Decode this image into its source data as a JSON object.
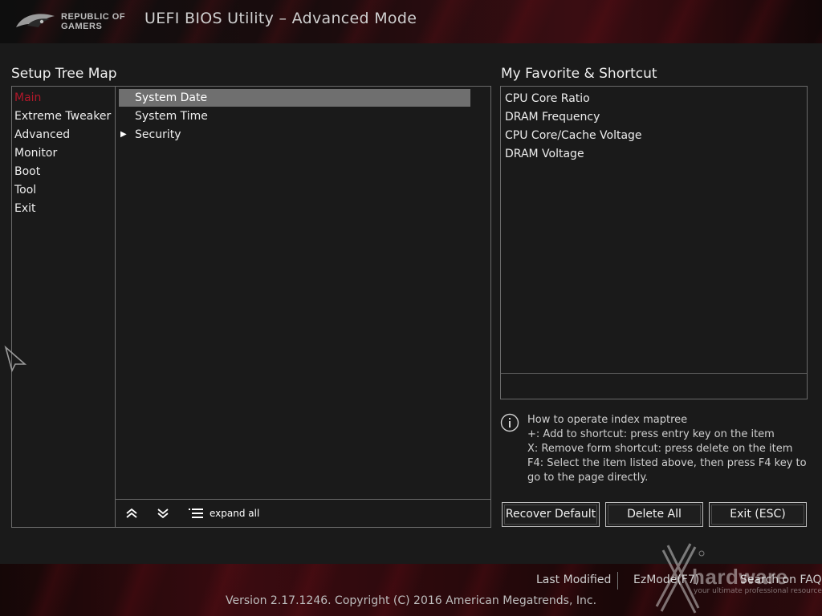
{
  "header": {
    "logo_line1": "REPUBLIC OF",
    "logo_line2": "GAMERS",
    "title": "UEFI BIOS Utility – Advanced Mode"
  },
  "setup_tree": {
    "title": "Setup Tree Map",
    "menu": [
      {
        "label": "Main",
        "active": true
      },
      {
        "label": "Extreme Tweaker"
      },
      {
        "label": "Advanced"
      },
      {
        "label": "Monitor"
      },
      {
        "label": "Boot"
      },
      {
        "label": "Tool"
      },
      {
        "label": "Exit"
      }
    ],
    "items": [
      {
        "label": "System Date",
        "selected": true
      },
      {
        "label": "System Time"
      },
      {
        "label": "Security",
        "expandable": true
      }
    ],
    "controls": {
      "collapse_icon": "double-chevron-up-icon",
      "expand_icon": "double-chevron-down-icon",
      "expand_all_icon": "list-icon",
      "expand_all_label": "expand all"
    }
  },
  "favorites": {
    "title": "My Favorite & Shortcut",
    "items": [
      "CPU Core Ratio",
      "DRAM Frequency",
      "CPU Core/Cache Voltage",
      "DRAM Voltage"
    ]
  },
  "help": {
    "icon": "info-icon",
    "lines": [
      "How to operate index maptree",
      "+: Add to shortcut: press entry key on the item",
      "X: Remove form shortcut: press delete on the item",
      "F4: Select the item listed above, then press F4 key to",
      "go to the page directly."
    ]
  },
  "buttons": {
    "recover_default": "Recover Default",
    "delete_all": "Delete All",
    "exit": "Exit (ESC)"
  },
  "footer": {
    "last_modified": "Last Modified",
    "ez_mode": "EzMode(F7)",
    "search_faq": "Search on FAQ",
    "copyright": "Version 2.17.1246. Copyright (C) 2016 American Megatrends, Inc."
  },
  "watermark": {
    "brand": "hardware",
    "tagline": "your ultimate professional resource"
  },
  "colors": {
    "accent_red": "#b0182a",
    "selected_row": "#6f6f6f",
    "border": "#6a6a6a"
  }
}
